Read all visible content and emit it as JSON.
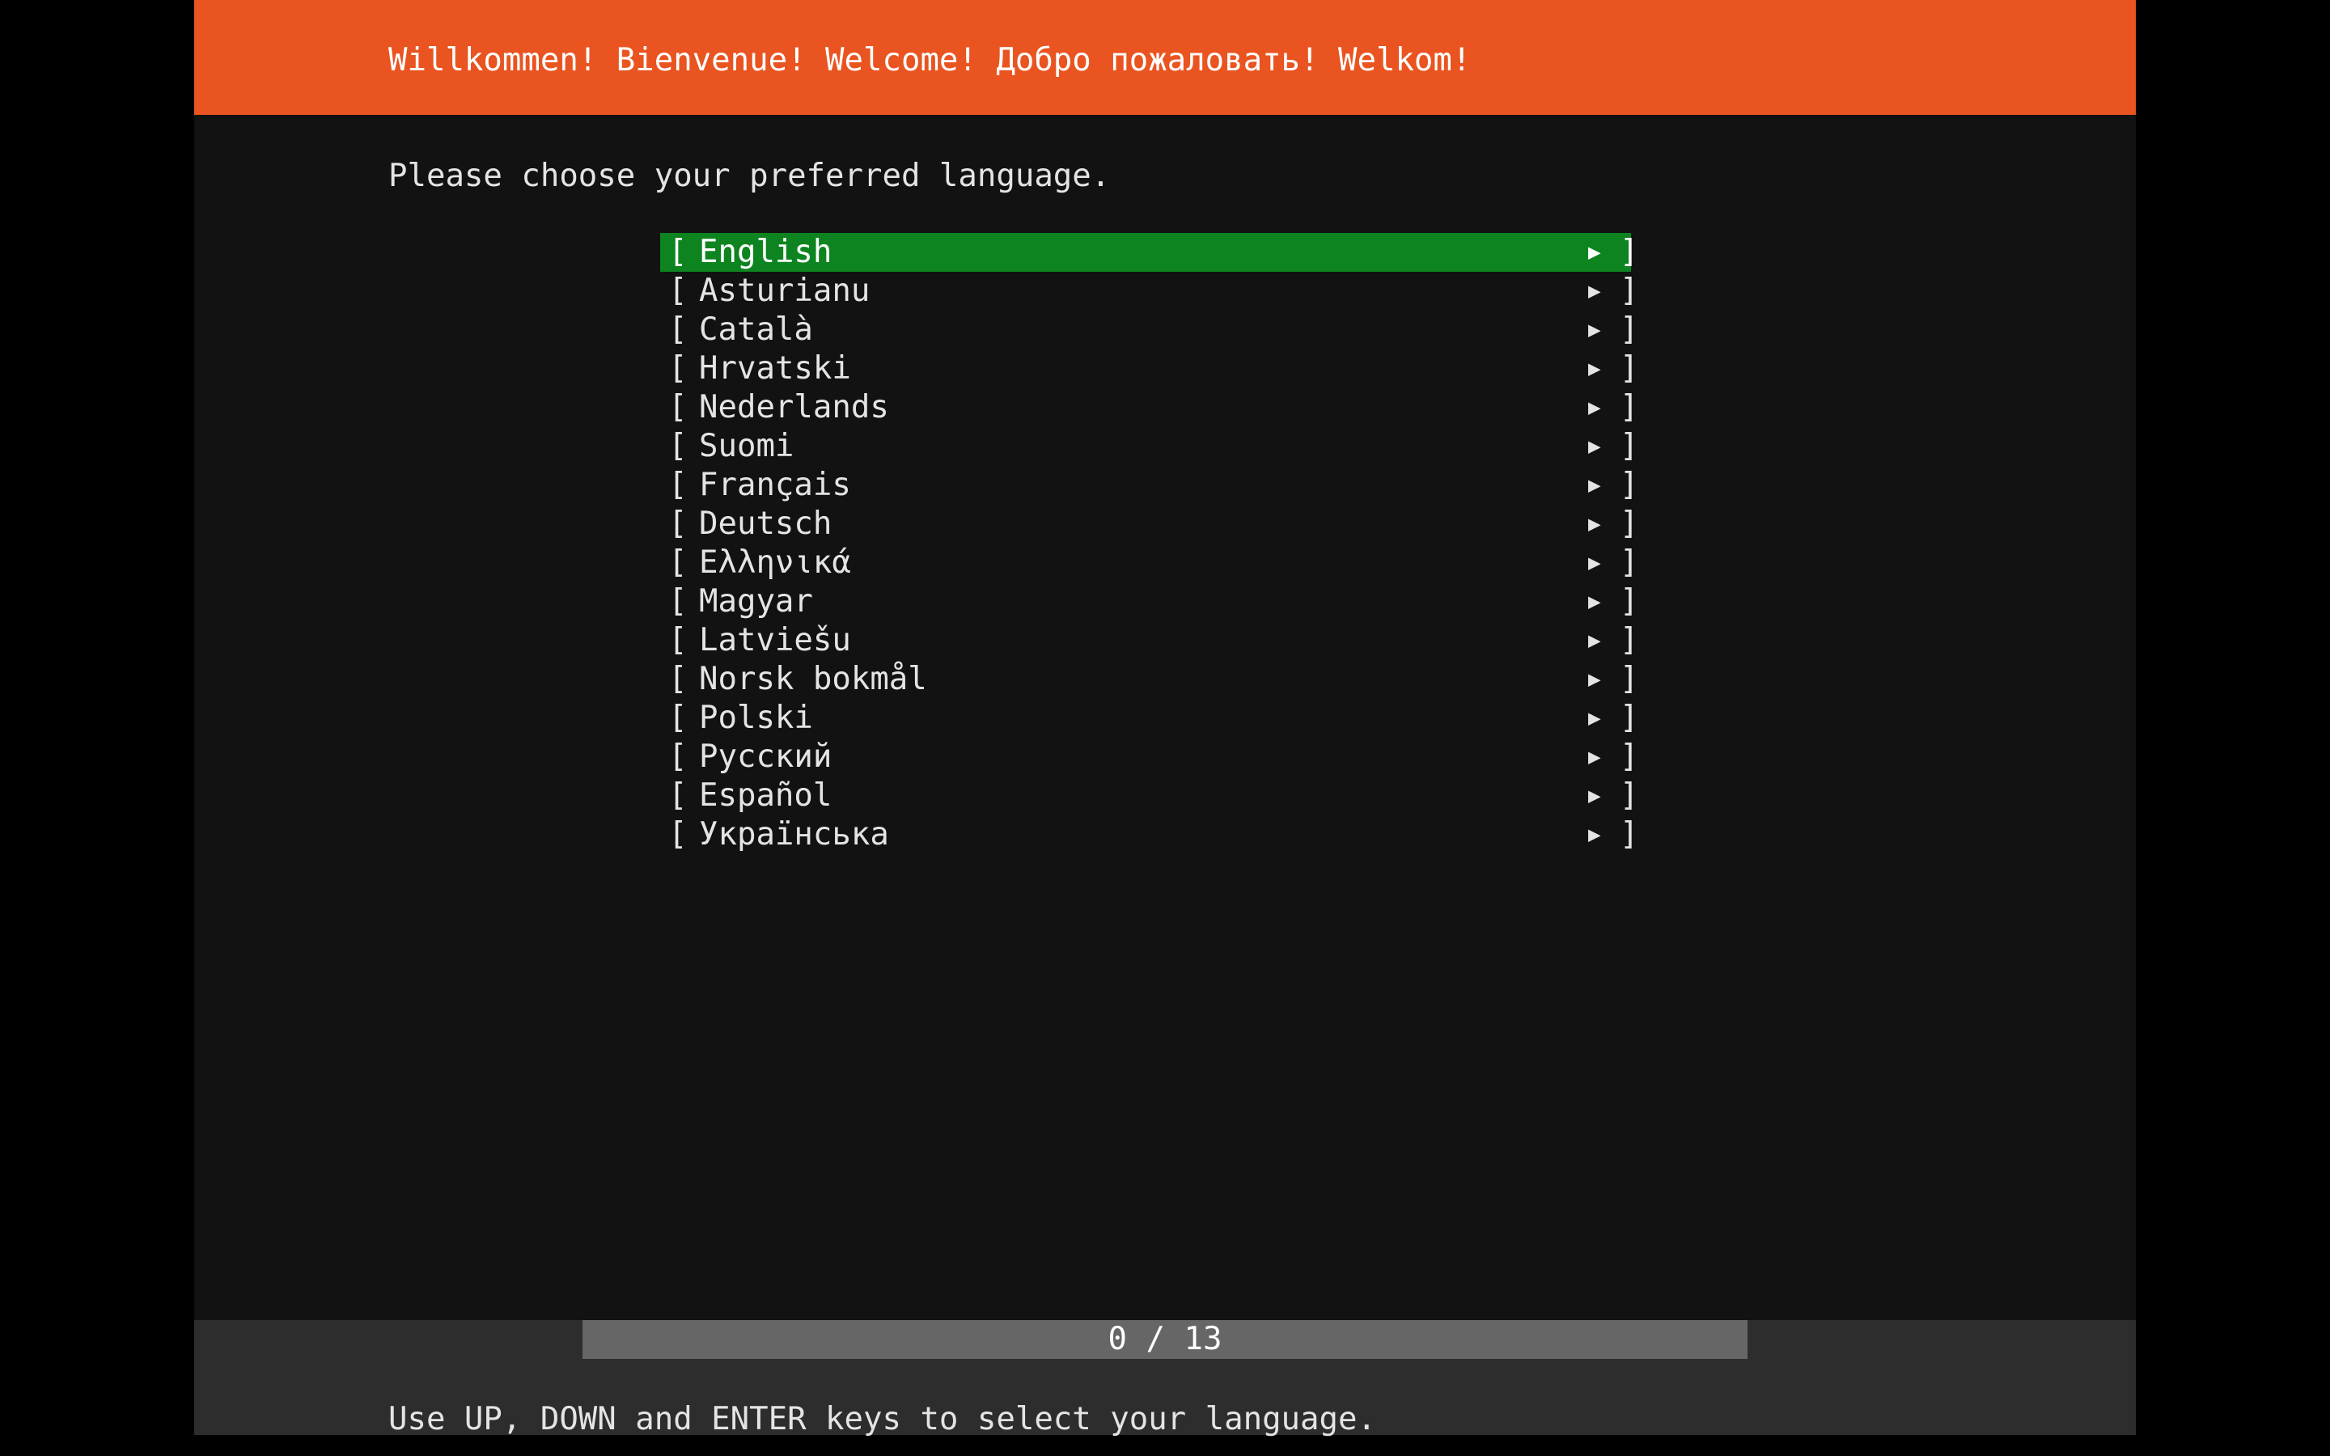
{
  "header": {
    "title": "Willkommen! Bienvenue! Welcome! Добро пожаловать! Welkom!",
    "color": "#e95420"
  },
  "prompt": "Please choose your preferred language.",
  "languages": {
    "selected_index": 0,
    "bracket_open": "[",
    "bracket_close": "]",
    "arrow": "▶",
    "selected_color": "#0e8420",
    "items": [
      {
        "label": "English"
      },
      {
        "label": "Asturianu"
      },
      {
        "label": "Català"
      },
      {
        "label": "Hrvatski"
      },
      {
        "label": "Nederlands"
      },
      {
        "label": "Suomi"
      },
      {
        "label": "Français"
      },
      {
        "label": "Deutsch"
      },
      {
        "label": "Ελληνικά"
      },
      {
        "label": "Magyar"
      },
      {
        "label": "Latviešu"
      },
      {
        "label": "Norsk bokmål"
      },
      {
        "label": "Polski"
      },
      {
        "label": "Русский"
      },
      {
        "label": "Español"
      },
      {
        "label": "Українська"
      }
    ]
  },
  "progress": {
    "text": "0 / 13",
    "current": 0,
    "total": 13
  },
  "hint": "Use UP, DOWN and ENTER keys to select your language."
}
